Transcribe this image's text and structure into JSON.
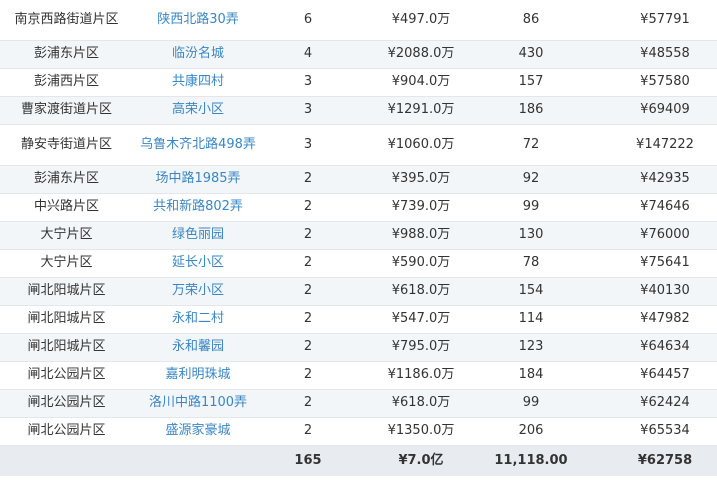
{
  "rows": [
    {
      "district": "南京西路街道片区",
      "community": "陕西北路30弄",
      "count": "6",
      "total_price": "¥497.0万",
      "area": "86",
      "unit_price": "¥57791"
    },
    {
      "district": "彭浦东片区",
      "community": "临汾名城",
      "count": "4",
      "total_price": "¥2088.0万",
      "area": "430",
      "unit_price": "¥48558"
    },
    {
      "district": "彭浦西片区",
      "community": "共康四村",
      "count": "3",
      "total_price": "¥904.0万",
      "area": "157",
      "unit_price": "¥57580"
    },
    {
      "district": "曹家渡街道片区",
      "community": "高荣小区",
      "count": "3",
      "total_price": "¥1291.0万",
      "area": "186",
      "unit_price": "¥69409"
    },
    {
      "district": "静安寺街道片区",
      "community": "乌鲁木齐北路498弄",
      "count": "3",
      "total_price": "¥1060.0万",
      "area": "72",
      "unit_price": "¥147222"
    },
    {
      "district": "彭浦东片区",
      "community": "场中路1985弄",
      "count": "2",
      "total_price": "¥395.0万",
      "area": "92",
      "unit_price": "¥42935"
    },
    {
      "district": "中兴路片区",
      "community": "共和新路802弄",
      "count": "2",
      "total_price": "¥739.0万",
      "area": "99",
      "unit_price": "¥74646"
    },
    {
      "district": "大宁片区",
      "community": "绿色丽园",
      "count": "2",
      "total_price": "¥988.0万",
      "area": "130",
      "unit_price": "¥76000"
    },
    {
      "district": "大宁片区",
      "community": "延长小区",
      "count": "2",
      "total_price": "¥590.0万",
      "area": "78",
      "unit_price": "¥75641"
    },
    {
      "district": "闸北阳城片区",
      "community": "万荣小区",
      "count": "2",
      "total_price": "¥618.0万",
      "area": "154",
      "unit_price": "¥40130"
    },
    {
      "district": "闸北阳城片区",
      "community": "永和二村",
      "count": "2",
      "total_price": "¥547.0万",
      "area": "114",
      "unit_price": "¥47982"
    },
    {
      "district": "闸北阳城片区",
      "community": "永和馨园",
      "count": "2",
      "total_price": "¥795.0万",
      "area": "123",
      "unit_price": "¥64634"
    },
    {
      "district": "闸北公园片区",
      "community": "嘉利明珠城",
      "count": "2",
      "total_price": "¥1186.0万",
      "area": "184",
      "unit_price": "¥64457"
    },
    {
      "district": "闸北公园片区",
      "community": "洛川中路1100弄",
      "count": "2",
      "total_price": "¥618.0万",
      "area": "99",
      "unit_price": "¥62424"
    },
    {
      "district": "闸北公园片区",
      "community": "盛源家豪城",
      "count": "2",
      "total_price": "¥1350.0万",
      "area": "206",
      "unit_price": "¥65534"
    }
  ],
  "footer": {
    "district": "",
    "community": "",
    "count": "165",
    "total_price": "¥7.0亿",
    "area": "11,118.00",
    "unit_price": "¥62758"
  },
  "colors": {
    "link": "#3a86c4",
    "stripe": "#f3f6f9",
    "footer_bg": "#e8ecf0"
  }
}
